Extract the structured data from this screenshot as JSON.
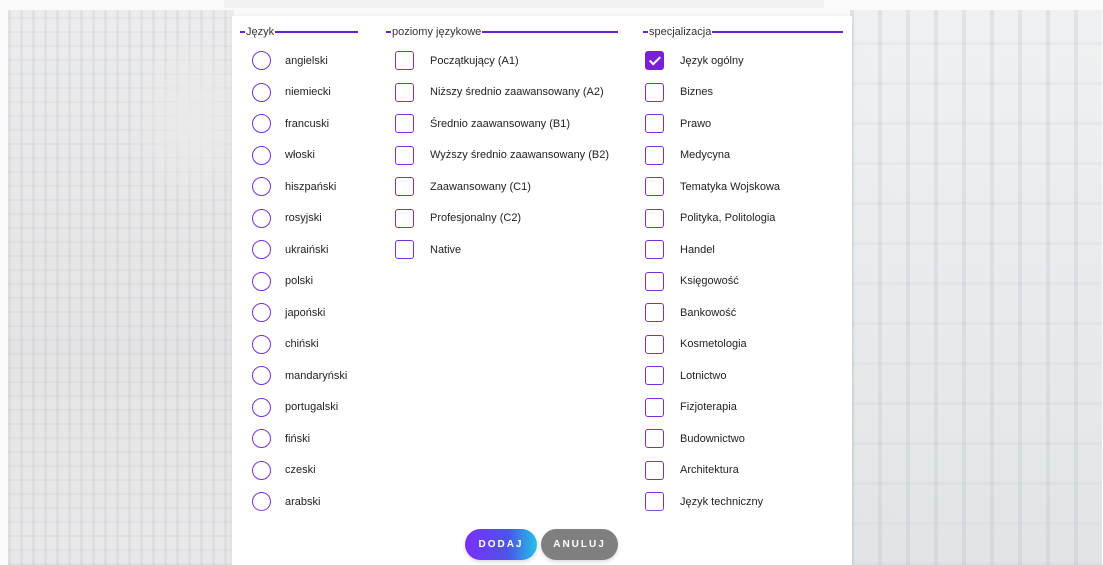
{
  "languages": {
    "legend": "Język",
    "items": [
      "angielski",
      "niemiecki",
      "francuski",
      "włoski",
      "hiszpański",
      "rosyjski",
      "ukraiński",
      "polski",
      "japoński",
      "chiński",
      "mandaryński",
      "portugalski",
      "fiński",
      "czeski",
      "arabski"
    ]
  },
  "levels": {
    "legend": "poziomy językowe",
    "items": [
      "Początkujący (A1)",
      "Niższy średnio zaawansowany (A2)",
      "Średnio zaawansowany (B1)",
      "Wyższy średnio zaawansowany (B2)",
      "Zaawansowany (C1)",
      "Profesjonalny (C2)",
      "Native"
    ]
  },
  "specializations": {
    "legend": "specjalizacja",
    "items": [
      {
        "label": "Język ogólny",
        "checked": true
      },
      {
        "label": "Biznes",
        "checked": false
      },
      {
        "label": "Prawo",
        "checked": false
      },
      {
        "label": "Medycyna",
        "checked": false
      },
      {
        "label": "Tematyka Wojskowa",
        "checked": false
      },
      {
        "label": "Polityka, Politologia",
        "checked": false
      },
      {
        "label": "Handel",
        "checked": false
      },
      {
        "label": "Księgowość",
        "checked": false
      },
      {
        "label": "Bankowość",
        "checked": false
      },
      {
        "label": "Kosmetologia",
        "checked": false
      },
      {
        "label": "Lotnictwo",
        "checked": false
      },
      {
        "label": "Fizjoterapia",
        "checked": false
      },
      {
        "label": "Budownictwo",
        "checked": false
      },
      {
        "label": "Architektura",
        "checked": false
      },
      {
        "label": "Język techniczny",
        "checked": false
      }
    ]
  },
  "actions": {
    "add_label": "DODAJ",
    "cancel_label": "ANULUJ"
  },
  "colors": {
    "accent": "#7a1fd6",
    "cancel": "#7f7f7f"
  },
  "icons": {
    "checked": "checkmark-icon"
  }
}
